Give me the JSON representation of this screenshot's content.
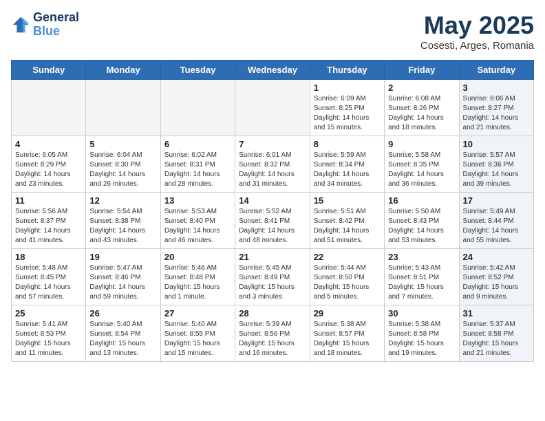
{
  "header": {
    "logo_line1": "General",
    "logo_line2": "Blue",
    "month": "May 2025",
    "location": "Cosesti, Arges, Romania"
  },
  "weekdays": [
    "Sunday",
    "Monday",
    "Tuesday",
    "Wednesday",
    "Thursday",
    "Friday",
    "Saturday"
  ],
  "weeks": [
    [
      {
        "day": "",
        "info": "",
        "empty": true
      },
      {
        "day": "",
        "info": "",
        "empty": true
      },
      {
        "day": "",
        "info": "",
        "empty": true
      },
      {
        "day": "",
        "info": "",
        "empty": true
      },
      {
        "day": "1",
        "info": "Sunrise: 6:09 AM\nSunset: 8:25 PM\nDaylight: 14 hours\nand 15 minutes.",
        "empty": false
      },
      {
        "day": "2",
        "info": "Sunrise: 6:08 AM\nSunset: 8:26 PM\nDaylight: 14 hours\nand 18 minutes.",
        "empty": false
      },
      {
        "day": "3",
        "info": "Sunrise: 6:06 AM\nSunset: 8:27 PM\nDaylight: 14 hours\nand 21 minutes.",
        "empty": false
      }
    ],
    [
      {
        "day": "4",
        "info": "Sunrise: 6:05 AM\nSunset: 8:29 PM\nDaylight: 14 hours\nand 23 minutes.",
        "empty": false
      },
      {
        "day": "5",
        "info": "Sunrise: 6:04 AM\nSunset: 8:30 PM\nDaylight: 14 hours\nand 26 minutes.",
        "empty": false
      },
      {
        "day": "6",
        "info": "Sunrise: 6:02 AM\nSunset: 8:31 PM\nDaylight: 14 hours\nand 28 minutes.",
        "empty": false
      },
      {
        "day": "7",
        "info": "Sunrise: 6:01 AM\nSunset: 8:32 PM\nDaylight: 14 hours\nand 31 minutes.",
        "empty": false
      },
      {
        "day": "8",
        "info": "Sunrise: 5:59 AM\nSunset: 8:34 PM\nDaylight: 14 hours\nand 34 minutes.",
        "empty": false
      },
      {
        "day": "9",
        "info": "Sunrise: 5:58 AM\nSunset: 8:35 PM\nDaylight: 14 hours\nand 36 minutes.",
        "empty": false
      },
      {
        "day": "10",
        "info": "Sunrise: 5:57 AM\nSunset: 8:36 PM\nDaylight: 14 hours\nand 39 minutes.",
        "empty": false
      }
    ],
    [
      {
        "day": "11",
        "info": "Sunrise: 5:56 AM\nSunset: 8:37 PM\nDaylight: 14 hours\nand 41 minutes.",
        "empty": false
      },
      {
        "day": "12",
        "info": "Sunrise: 5:54 AM\nSunset: 8:38 PM\nDaylight: 14 hours\nand 43 minutes.",
        "empty": false
      },
      {
        "day": "13",
        "info": "Sunrise: 5:53 AM\nSunset: 8:40 PM\nDaylight: 14 hours\nand 46 minutes.",
        "empty": false
      },
      {
        "day": "14",
        "info": "Sunrise: 5:52 AM\nSunset: 8:41 PM\nDaylight: 14 hours\nand 48 minutes.",
        "empty": false
      },
      {
        "day": "15",
        "info": "Sunrise: 5:51 AM\nSunset: 8:42 PM\nDaylight: 14 hours\nand 51 minutes.",
        "empty": false
      },
      {
        "day": "16",
        "info": "Sunrise: 5:50 AM\nSunset: 8:43 PM\nDaylight: 14 hours\nand 53 minutes.",
        "empty": false
      },
      {
        "day": "17",
        "info": "Sunrise: 5:49 AM\nSunset: 8:44 PM\nDaylight: 14 hours\nand 55 minutes.",
        "empty": false
      }
    ],
    [
      {
        "day": "18",
        "info": "Sunrise: 5:48 AM\nSunset: 8:45 PM\nDaylight: 14 hours\nand 57 minutes.",
        "empty": false
      },
      {
        "day": "19",
        "info": "Sunrise: 5:47 AM\nSunset: 8:46 PM\nDaylight: 14 hours\nand 59 minutes.",
        "empty": false
      },
      {
        "day": "20",
        "info": "Sunrise: 5:46 AM\nSunset: 8:48 PM\nDaylight: 15 hours\nand 1 minute.",
        "empty": false
      },
      {
        "day": "21",
        "info": "Sunrise: 5:45 AM\nSunset: 8:49 PM\nDaylight: 15 hours\nand 3 minutes.",
        "empty": false
      },
      {
        "day": "22",
        "info": "Sunrise: 5:44 AM\nSunset: 8:50 PM\nDaylight: 15 hours\nand 5 minutes.",
        "empty": false
      },
      {
        "day": "23",
        "info": "Sunrise: 5:43 AM\nSunset: 8:51 PM\nDaylight: 15 hours\nand 7 minutes.",
        "empty": false
      },
      {
        "day": "24",
        "info": "Sunrise: 5:42 AM\nSunset: 8:52 PM\nDaylight: 15 hours\nand 9 minutes.",
        "empty": false
      }
    ],
    [
      {
        "day": "25",
        "info": "Sunrise: 5:41 AM\nSunset: 8:53 PM\nDaylight: 15 hours\nand 11 minutes.",
        "empty": false
      },
      {
        "day": "26",
        "info": "Sunrise: 5:40 AM\nSunset: 8:54 PM\nDaylight: 15 hours\nand 13 minutes.",
        "empty": false
      },
      {
        "day": "27",
        "info": "Sunrise: 5:40 AM\nSunset: 8:55 PM\nDaylight: 15 hours\nand 15 minutes.",
        "empty": false
      },
      {
        "day": "28",
        "info": "Sunrise: 5:39 AM\nSunset: 8:56 PM\nDaylight: 15 hours\nand 16 minutes.",
        "empty": false
      },
      {
        "day": "29",
        "info": "Sunrise: 5:38 AM\nSunset: 8:57 PM\nDaylight: 15 hours\nand 18 minutes.",
        "empty": false
      },
      {
        "day": "30",
        "info": "Sunrise: 5:38 AM\nSunset: 8:58 PM\nDaylight: 15 hours\nand 19 minutes.",
        "empty": false
      },
      {
        "day": "31",
        "info": "Sunrise: 5:37 AM\nSunset: 8:58 PM\nDaylight: 15 hours\nand 21 minutes.",
        "empty": false
      }
    ]
  ]
}
